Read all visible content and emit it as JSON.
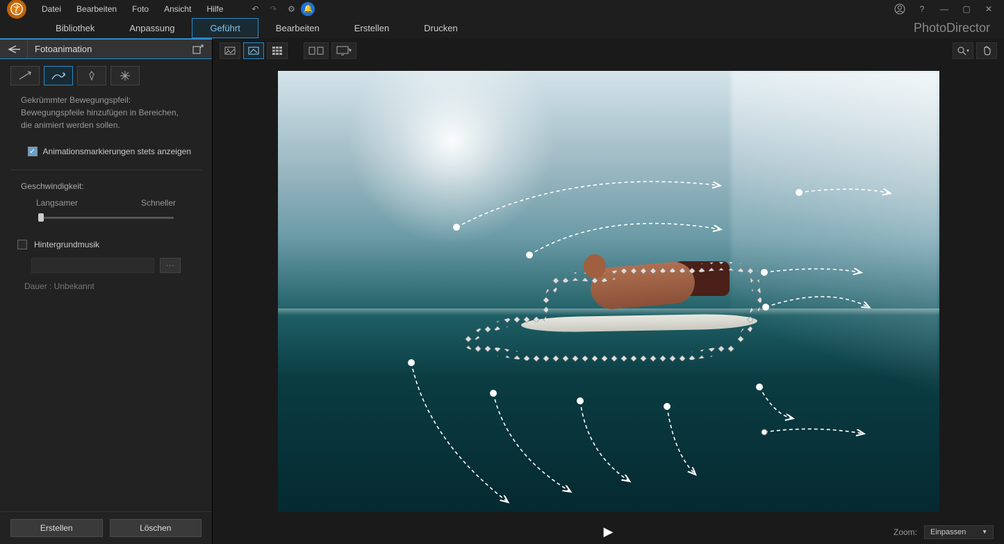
{
  "menu": {
    "file": "Datei",
    "edit": "Bearbeiten",
    "photo": "Foto",
    "view": "Ansicht",
    "help": "Hilfe"
  },
  "tabs": {
    "library": "Bibliothek",
    "adjust": "Anpassung",
    "guided": "Geführt",
    "editpg": "Bearbeiten",
    "create": "Erstellen",
    "print": "Drucken"
  },
  "brand": "PhotoDirector",
  "panel": {
    "title": "Fotoanimation",
    "desc_title": "Gekrümmter Bewegungspfeil:",
    "desc_body": "Bewegungspfeile hinzufügen in Bereichen, die animiert werden sollen.",
    "check_label": "Animationsmarkierungen stets anzeigen",
    "speed_label": "Geschwindigkeit:",
    "slower": "Langsamer",
    "faster": "Schneller",
    "bg_music": "Hintergrundmusik",
    "duration": "Dauer : Unbekannt",
    "create_btn": "Erstellen",
    "delete_btn": "Löschen"
  },
  "zoom": {
    "label": "Zoom:",
    "value": "Einpassen"
  }
}
